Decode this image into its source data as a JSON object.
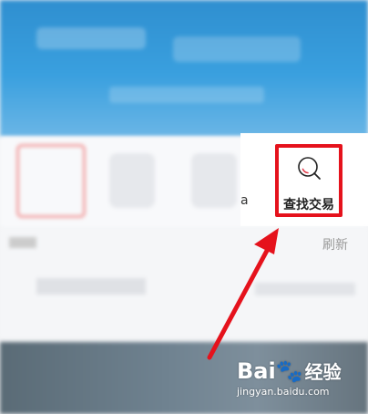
{
  "menu": {
    "partial_label": "a",
    "find_trade_label": "查找交易"
  },
  "feed": {
    "refresh_label": "刷新"
  },
  "watermark": {
    "brand_latin": "Bai",
    "brand_cjk": "经验",
    "url": "jingyan.baidu.com"
  },
  "colors": {
    "highlight": "#e5121c",
    "icon_accent": "#e23b4a",
    "banner": "#3aa0df"
  },
  "icons": {
    "find_trade": "magnifier-icon"
  }
}
